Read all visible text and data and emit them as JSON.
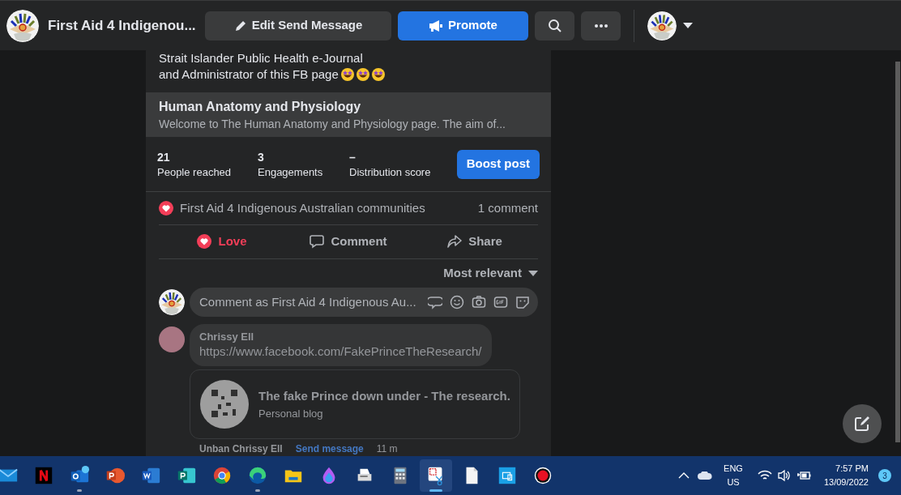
{
  "top_bar": {
    "page_name": "First Aid 4 Indigenou...",
    "edit_button": "Edit Send Message",
    "promote_button": "Promote"
  },
  "post": {
    "text_lines": [
      "Strait Islander Public Health e-Journal",
      "and Administrator of this FB page"
    ],
    "link_preview": {
      "title": "Human Anatomy and Physiology",
      "description": "Welcome to The Human Anatomy and Physiology page. The aim of..."
    },
    "stats": [
      {
        "value": "21",
        "label": "People reached"
      },
      {
        "value": "3",
        "label": "Engagements"
      },
      {
        "value": "–",
        "label": "Distribution score"
      }
    ],
    "boost_button": "Boost post",
    "reactions_by": "First Aid 4 Indigenous Australian communities",
    "comment_count": "1 comment",
    "actions": [
      {
        "label": "Love",
        "selected": true
      },
      {
        "label": "Comment",
        "selected": false
      },
      {
        "label": "Share",
        "selected": false
      }
    ],
    "sort": "Most relevant",
    "comment_placeholder": "Comment as First Aid 4 Indigenous Au...",
    "comments": [
      {
        "author": "Chrissy Ell",
        "text": "https://www.facebook.com/FakePrinceTheResearch/",
        "preview_title": "The fake Prince down under - The research.",
        "preview_subtitle": "Personal blog",
        "actions": [
          "Unban Chrissy Ell",
          "Send message"
        ],
        "time": "11 m"
      }
    ]
  },
  "taskbar": {
    "apps": [
      {
        "selected": false,
        "running": false
      },
      {
        "selected": false,
        "running": false
      },
      {
        "selected": false,
        "running": true
      },
      {
        "selected": false,
        "running": false
      },
      {
        "selected": false,
        "running": false
      },
      {
        "selected": false,
        "running": false
      },
      {
        "selected": false,
        "running": false
      },
      {
        "selected": false,
        "running": true
      },
      {
        "selected": false,
        "running": false
      },
      {
        "selected": false,
        "running": false
      },
      {
        "selected": false,
        "running": false
      },
      {
        "selected": false,
        "running": false
      },
      {
        "selected": true,
        "running": true
      },
      {
        "selected": false,
        "running": false
      },
      {
        "selected": false,
        "running": false
      },
      {
        "selected": false,
        "running": false
      }
    ],
    "language": [
      "ENG",
      "US"
    ],
    "time": "7:57 PM",
    "date": "13/09/2022",
    "notifications": "3"
  }
}
